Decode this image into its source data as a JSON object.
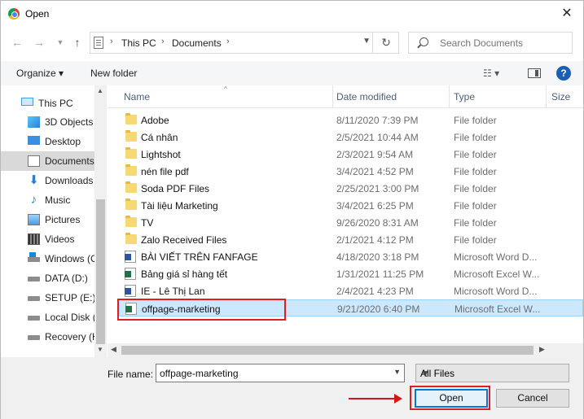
{
  "window": {
    "title": "Open"
  },
  "address": {
    "crumbs": [
      "This PC",
      "Documents"
    ],
    "separator": "›"
  },
  "search": {
    "placeholder": "Search Documents"
  },
  "toolbar": {
    "organize": "Organize ▾",
    "new_folder": "New folder",
    "help": "?"
  },
  "nav": {
    "items": [
      {
        "label": "This PC",
        "icon": "computer-icon"
      },
      {
        "label": "3D Objects",
        "icon": "cube-icon"
      },
      {
        "label": "Desktop",
        "icon": "desktop-icon"
      },
      {
        "label": "Documents",
        "icon": "document-icon",
        "selected": true
      },
      {
        "label": "Downloads",
        "icon": "download-icon"
      },
      {
        "label": "Music",
        "icon": "music-icon"
      },
      {
        "label": "Pictures",
        "icon": "picture-icon"
      },
      {
        "label": "Videos",
        "icon": "video-icon"
      },
      {
        "label": "Windows (C",
        "icon": "windows-drive-icon"
      },
      {
        "label": "DATA (D:)",
        "icon": "drive-icon"
      },
      {
        "label": "SETUP (E:)",
        "icon": "drive-icon"
      },
      {
        "label": "Local Disk (",
        "icon": "drive-icon"
      },
      {
        "label": "Recovery (H",
        "icon": "drive-icon"
      }
    ]
  },
  "columns": {
    "name": "Name",
    "date": "Date modified",
    "type": "Type",
    "size": "Size"
  },
  "files": [
    {
      "name": "Adobe",
      "date": "8/11/2020 7:39 PM",
      "type": "File folder",
      "kind": "folder"
    },
    {
      "name": "Cá nhân",
      "date": "2/5/2021 10:44 AM",
      "type": "File folder",
      "kind": "folder"
    },
    {
      "name": "Lightshot",
      "date": "2/3/2021 9:54 AM",
      "type": "File folder",
      "kind": "folder"
    },
    {
      "name": "nén file pdf",
      "date": "3/4/2021 4:52 PM",
      "type": "File folder",
      "kind": "folder"
    },
    {
      "name": "Soda PDF Files",
      "date": "2/25/2021 3:00 PM",
      "type": "File folder",
      "kind": "folder"
    },
    {
      "name": "Tài liệu Marketing",
      "date": "3/4/2021 6:25 PM",
      "type": "File folder",
      "kind": "folder"
    },
    {
      "name": "TV",
      "date": "9/26/2020 8:31 AM",
      "type": "File folder",
      "kind": "folder"
    },
    {
      "name": "Zalo Received Files",
      "date": "2/1/2021 4:12 PM",
      "type": "File folder",
      "kind": "folder"
    },
    {
      "name": "BÀI VIẾT TRÊN FANFAGE",
      "date": "4/18/2020 3:18 PM",
      "type": "Microsoft Word D...",
      "kind": "word"
    },
    {
      "name": "Bảng giá sỉ hàng tết",
      "date": "1/31/2021 11:25 PM",
      "type": "Microsoft Excel W...",
      "kind": "excel"
    },
    {
      "name": "IE - Lê Thị Lan",
      "date": "2/4/2021 4:23 PM",
      "type": "Microsoft Word D...",
      "kind": "word"
    },
    {
      "name": "offpage-marketing",
      "date": "9/21/2020 6:40 PM",
      "type": "Microsoft Excel W...",
      "kind": "excel",
      "selected": true
    }
  ],
  "bottom": {
    "file_name_label": "File name:",
    "file_name_value": "offpage-marketing",
    "file_type": "All Files",
    "open_label": "Open",
    "cancel_label": "Cancel"
  },
  "colors": {
    "highlight_box": "#e01e1e",
    "selection": "#cce8ff",
    "accent": "#0078d7"
  }
}
